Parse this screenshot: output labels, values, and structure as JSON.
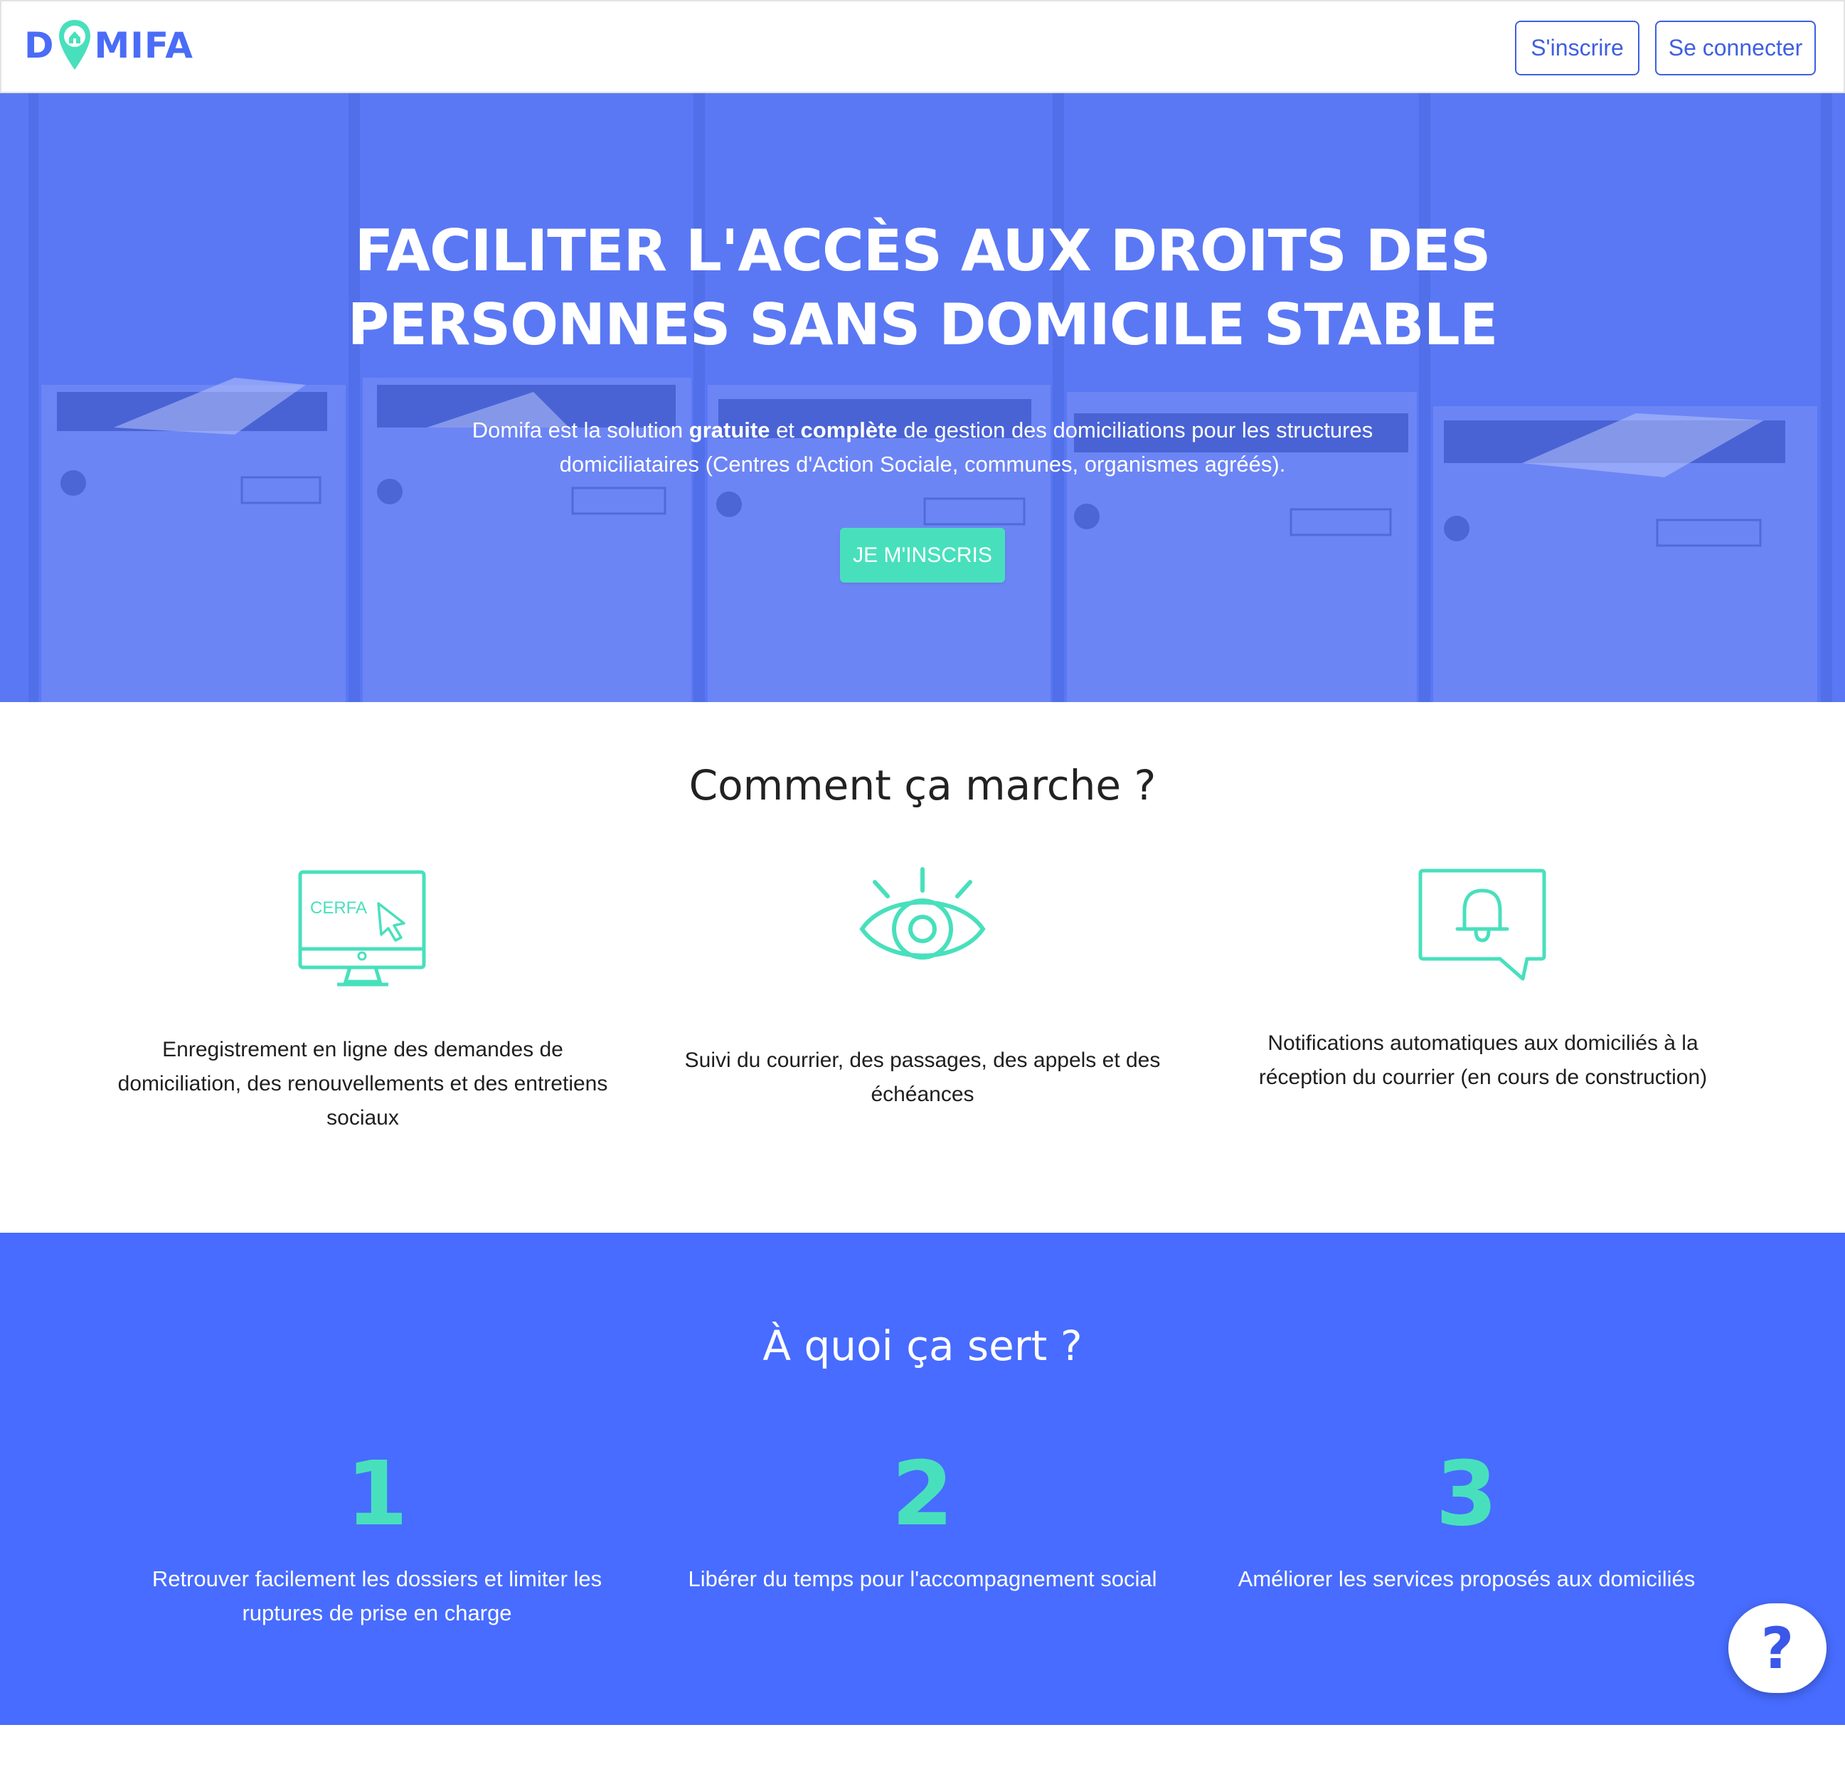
{
  "header": {
    "logo_text_start": "D",
    "logo_text_end": "MIFA",
    "signup_label": "S'inscrire",
    "login_label": "Se connecter"
  },
  "hero": {
    "title_line1": "FACILITER L'ACCÈS AUX DROITS DES",
    "title_line2": "PERSONNES SANS DOMICILE STABLE",
    "desc_part1": "Domifa est la solution ",
    "desc_bold1": "gratuite",
    "desc_part2": " et ",
    "desc_bold2": "complète",
    "desc_part3": " de gestion des domiciliations pour les structures domiciliataires (Centres d'Action Sociale, communes, organismes agréés).",
    "cta_label": "JE M'INSCRIS"
  },
  "how": {
    "title": "Comment ça marche ?",
    "features": [
      {
        "icon": "computer-cerfa-icon",
        "icon_text": "CERFA",
        "text": "Enregistrement en ligne des demandes de domiciliation, des renouvellements et des entretiens sociaux"
      },
      {
        "icon": "eye-icon",
        "text": "Suivi du courrier, des passages, des appels et des échéances"
      },
      {
        "icon": "notification-bell-icon",
        "text": "Notifications automatiques aux domiciliés à la réception du courrier (en cours de construction)"
      }
    ]
  },
  "purpose": {
    "title": "À quoi ça sert ?",
    "items": [
      {
        "number": "1",
        "text": "Retrouver facilement les dossiers et limiter les ruptures de prise en charge"
      },
      {
        "number": "2",
        "text": "Libérer du temps pour l'accompagnement social"
      },
      {
        "number": "3",
        "text": "Améliorer les services proposés aux domiciliés"
      }
    ]
  },
  "help": {
    "label": "?"
  },
  "colors": {
    "brand_blue": "#476cff",
    "hero_overlay": "#5a78f4",
    "accent_green": "#48e0bc",
    "button_border": "#3f5fe0"
  }
}
